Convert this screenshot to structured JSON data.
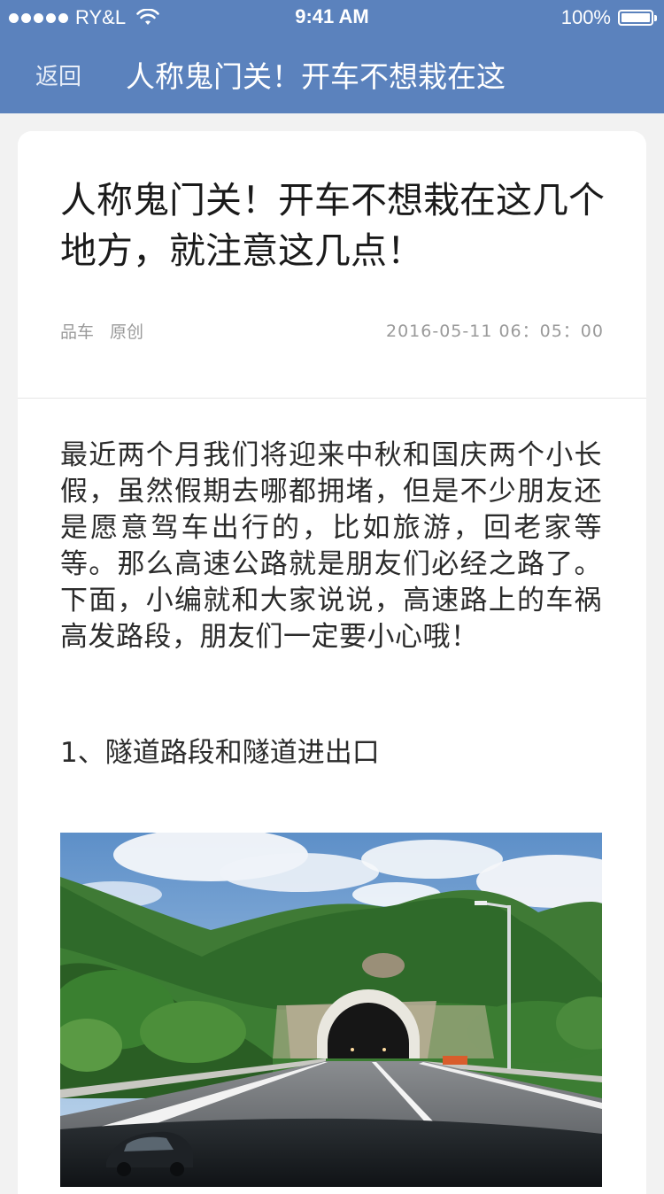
{
  "status_bar": {
    "carrier": "RY&L",
    "time": "9:41 AM",
    "battery": "100%"
  },
  "nav": {
    "back_label": "返回",
    "title": "人称鬼门关！开车不想栽在这"
  },
  "article": {
    "title": "人称鬼门关！开车不想栽在这几个地方，就注意这几点！",
    "source": "品车",
    "source_type": "原创",
    "date": "2016-05-11 06：05：00",
    "paragraph": "最近两个月我们将迎来中秋和国庆两个小长假，虽然假期去哪都拥堵，但是不少朋友还是愿意驾车出行的，比如旅游，回老家等等。那么高速公路就是朋友们必经之路了。下面，小编就和大家说说，高速路上的车祸高发路段，朋友们一定要小心哦！",
    "section_heading": "1、隧道路段和隧道进出口"
  },
  "icons": {
    "signal": "signal-dots-icon",
    "wifi": "wifi-icon",
    "battery": "battery-icon"
  },
  "colors": {
    "nav_bar": "#5b82bd",
    "background": "#f2f2f2",
    "card": "#ffffff",
    "meta_text": "#9a9a9a"
  }
}
